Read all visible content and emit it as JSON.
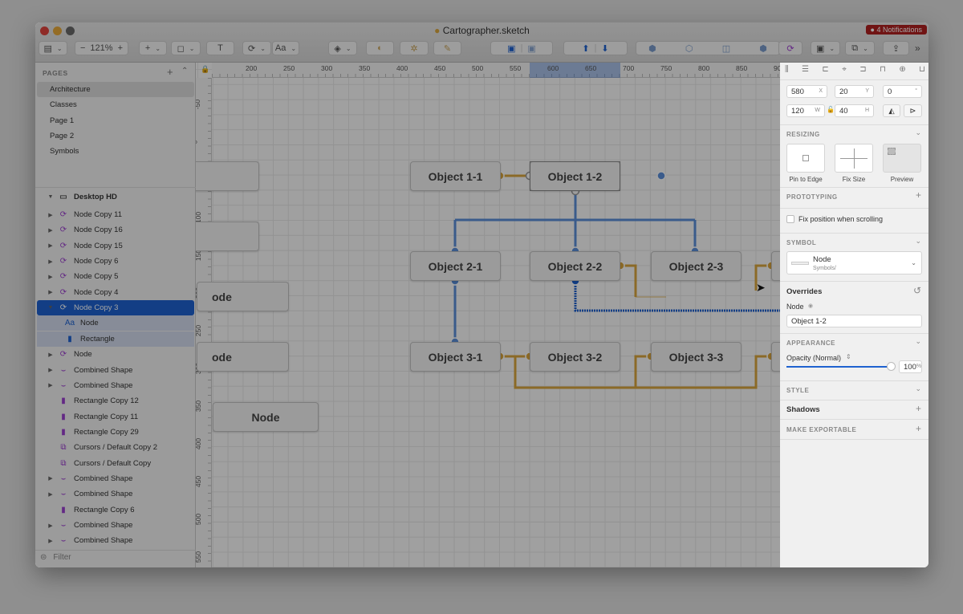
{
  "window": {
    "title": "Cartographer.sketch",
    "notifications": "● 4 Notifications"
  },
  "toolbar": {
    "zoom": "121%",
    "zoom_minus": "−",
    "zoom_plus": "+",
    "insert": "+",
    "text_tool": "T",
    "type_tool": "Aa",
    "overflow": "»"
  },
  "pages": {
    "header": "PAGES",
    "items": [
      "Architecture",
      "Classes",
      "Page 1",
      "Page 2",
      "Symbols"
    ],
    "selected": "Architecture"
  },
  "layers": {
    "artboard": "Desktop HD",
    "items": [
      {
        "label": "Node Copy 11",
        "icon": "symbol-icon",
        "expand": true
      },
      {
        "label": "Node Copy 16",
        "icon": "symbol-icon",
        "expand": true
      },
      {
        "label": "Node Copy 15",
        "icon": "symbol-icon",
        "expand": true
      },
      {
        "label": "Node Copy 6",
        "icon": "symbol-icon",
        "expand": true
      },
      {
        "label": "Node Copy 5",
        "icon": "symbol-icon",
        "expand": true
      },
      {
        "label": "Node Copy 4",
        "icon": "symbol-icon",
        "expand": true
      },
      {
        "label": "Node Copy 3",
        "icon": "symbol-icon",
        "expand": true,
        "selected": true
      },
      {
        "label": "Node",
        "icon": "text-icon",
        "child": true
      },
      {
        "label": "Rectangle",
        "icon": "rectangle-icon",
        "child": true
      },
      {
        "label": "Node",
        "icon": "symbol-icon",
        "expand": true
      },
      {
        "label": "Combined Shape",
        "icon": "shape-icon",
        "expand": true
      },
      {
        "label": "Combined Shape",
        "icon": "shape-icon",
        "expand": true
      },
      {
        "label": "Rectangle Copy 12",
        "icon": "rectangle-icon"
      },
      {
        "label": "Rectangle Copy 11",
        "icon": "rectangle-icon"
      },
      {
        "label": "Rectangle Copy 29",
        "icon": "rectangle-icon"
      },
      {
        "label": "Cursors / Default Copy 2",
        "icon": "symbol-instance-icon"
      },
      {
        "label": "Cursors / Default Copy",
        "icon": "symbol-instance-icon"
      },
      {
        "label": "Combined Shape",
        "icon": "shape-icon",
        "expand": true
      },
      {
        "label": "Combined Shape",
        "icon": "shape-icon",
        "expand": true
      },
      {
        "label": "Rectangle Copy 6",
        "icon": "rectangle-icon"
      },
      {
        "label": "Combined Shape",
        "icon": "shape-icon",
        "expand": true
      },
      {
        "label": "Combined Shape",
        "icon": "shape-icon",
        "expand": true
      }
    ],
    "filter_placeholder": "Filter"
  },
  "rulers": {
    "top": [
      "200",
      "250",
      "300",
      "350",
      "400",
      "450",
      "500",
      "550",
      "600",
      "650",
      "700",
      "750",
      "800",
      "850",
      "900"
    ],
    "left": [
      "-50",
      "0",
      "50",
      "100",
      "150",
      "200",
      "250",
      "300",
      "350",
      "400",
      "450",
      "500",
      "550"
    ]
  },
  "canvas": {
    "nodes": [
      "Object 1-1",
      "Object 1-2",
      "Object 2-1",
      "Object 2-2",
      "Object 2-3",
      "Object 3-1",
      "Object 3-2",
      "Object 3-3"
    ],
    "partial_nodes": [
      "ode",
      "ode",
      "Node"
    ]
  },
  "inspector": {
    "x": "580",
    "x_label": "X",
    "y": "20",
    "y_label": "Y",
    "rotation": "0",
    "rotation_unit": "°",
    "w": "120",
    "w_label": "W",
    "h": "40",
    "h_label": "H",
    "resizing": "RESIZING",
    "pin_to_edge": "Pin to Edge",
    "fix_size": "Fix Size",
    "preview": "Preview",
    "prototyping": "PROTOTYPING",
    "fix_position": "Fix position when scrolling",
    "fix_position_checked": false,
    "symbol": "SYMBOL",
    "symbol_name": "Node",
    "symbol_path": "Symbols/",
    "overrides": "Overrides",
    "override_label": "Node",
    "override_value": "Object 1-2",
    "appearance": "APPEARANCE",
    "opacity_label": "Opacity (Normal)",
    "opacity_value": "100",
    "opacity_unit": "%",
    "style": "STYLE",
    "shadows": "Shadows",
    "make_exportable": "MAKE EXPORTABLE"
  },
  "colors": {
    "accent": "#1e62d0",
    "connector_blue": "#5b8fd9",
    "connector_gold": "#d9a63e",
    "notification": "#b02020",
    "symbol": "#9b3fcf"
  }
}
